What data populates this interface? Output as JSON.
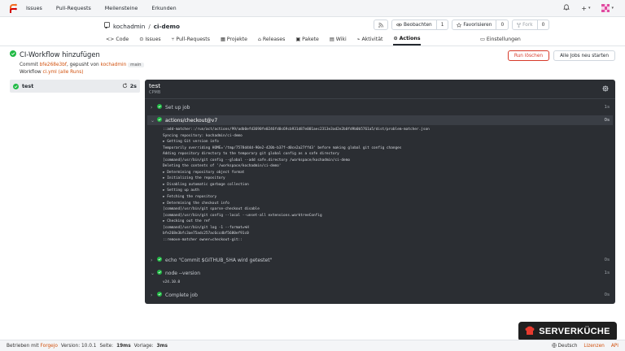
{
  "topnav": {
    "links": [
      "Issues",
      "Pull-Requests",
      "Meilensteine",
      "Erkunden"
    ],
    "plus_label": "+",
    "caret": "▾"
  },
  "repo": {
    "owner": "kochadmin",
    "separator": "/",
    "name": "ci-demo",
    "actions": {
      "rss_label": "",
      "watch_label": "Beobachten",
      "watch_count": "1",
      "star_label": "Favorisieren",
      "star_count": "0",
      "fork_label": "Fork",
      "fork_count": "0"
    },
    "tabs": [
      {
        "label": "Code",
        "icon": "code-icon"
      },
      {
        "label": "Issues",
        "icon": "issue-icon"
      },
      {
        "label": "Pull-Requests",
        "icon": "pull-request-icon"
      },
      {
        "label": "Projekte",
        "icon": "project-icon"
      },
      {
        "label": "Releases",
        "icon": "tag-icon"
      },
      {
        "label": "Pakete",
        "icon": "package-icon"
      },
      {
        "label": "Wiki",
        "icon": "book-icon"
      },
      {
        "label": "Aktivität",
        "icon": "pulse-icon"
      },
      {
        "label": "Actions",
        "icon": "play-icon"
      }
    ],
    "settings_label": "Einstellungen"
  },
  "run": {
    "title": "CI-Workflow hinzufügen",
    "commit_prefix": "Commit",
    "commit_sha": "bfe268e3bf",
    "pushed_by_text": ", gepusht von",
    "pusher": "kochadmin",
    "branch": "main",
    "workflow_prefix": "Workflow",
    "workflow_file": "ci.yml",
    "workflow_all_runs": "(alle Runs)",
    "rerun_label": "Run löschen",
    "rerun_all_label": "Alle Jobs neu starten"
  },
  "job": {
    "name": "test",
    "duration": "2s",
    "sublabel": "CPMB",
    "steps": [
      {
        "label": "Set up job",
        "duration": "1s",
        "open": false
      },
      {
        "label": "actions/checkout@v7",
        "duration": "0s",
        "open": true
      },
      {
        "label": "echo \"Commit $GITHUB_SHA wird getestet\"",
        "duration": "0s",
        "open": false
      },
      {
        "label": "node --version",
        "duration": "1s",
        "open": true
      },
      {
        "label": "Complete job",
        "duration": "0s",
        "open": false
      }
    ],
    "checkout_log": [
      "::add-matcher::/run/act/actions/99/adb0efd3690fe0246fd0c69cb931d87e001aec2313e3ad2e2b0fd9b0b5761a5/dist/problem-matcher.json",
      "Syncing repository: kochadmin/ci-demo",
      "► Getting Git version info",
      "Temporarily overriding HOME='/tmp/7578d44d-90e2-420b-b37f-d0ce2a27ffd3' before making global git config changes",
      "Adding repository directory to the temporary git global config as a safe directory",
      "[command]/usr/bin/git config --global --add safe.directory /workspace/kochadmin/ci-demo",
      "Deleting the contents of '/workspace/kochadmin/ci-demo'",
      "► Determining repository object format",
      "► Initializing the repository",
      "► Disabling automatic garbage collection",
      "► Setting up auth",
      "► Fetching the repository",
      "► Determining the checkout info",
      "[command]/usr/bin/git sparse-checkout disable",
      "[command]/usr/bin/git config --local --unset-all extensions.worktreeConfig",
      "► Checking out the ref",
      "[command]/usr/bin/git log -1 --format=%H",
      "bfe268e3bfc3ae75adc257ac6ccdbf5680ef91c0",
      "::remove-matcher owner=checkout-git::"
    ],
    "node_log": [
      "v24.10.0"
    ]
  },
  "footer": {
    "powered_prefix": "Betrieben mit",
    "powered_link": "Forgejo",
    "version_text": "Version: 10.0.1",
    "page_label": "Seite:",
    "page_time": "19ms",
    "template_label": "Vorlage:",
    "template_time": "3ms",
    "language": "Deutsch",
    "licenses": "Lizenzen",
    "api": "API"
  },
  "watermark": {
    "text": "SERVERKÜCHE"
  },
  "colors": {
    "accent": "#d1500c",
    "success": "#21ba45",
    "panel": "#2b2e33"
  }
}
